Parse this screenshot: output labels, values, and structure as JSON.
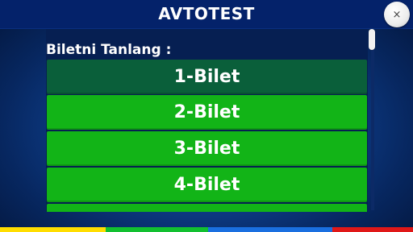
{
  "header": {
    "title": "AVTOTEST",
    "close_label": "×"
  },
  "main": {
    "heading": "Biletni Tanlang :",
    "tickets": [
      {
        "label": "1-Bilet",
        "selected": true
      },
      {
        "label": "2-Bilet",
        "selected": false
      },
      {
        "label": "3-Bilet",
        "selected": false
      },
      {
        "label": "4-Bilet",
        "selected": false
      }
    ]
  },
  "colors": {
    "ticket_active": "#12b417",
    "ticket_selected": "#0a5f3a",
    "stripe_colors": [
      "#ffdd00",
      "#12c030",
      "#1a6fe0",
      "#e01818"
    ]
  }
}
